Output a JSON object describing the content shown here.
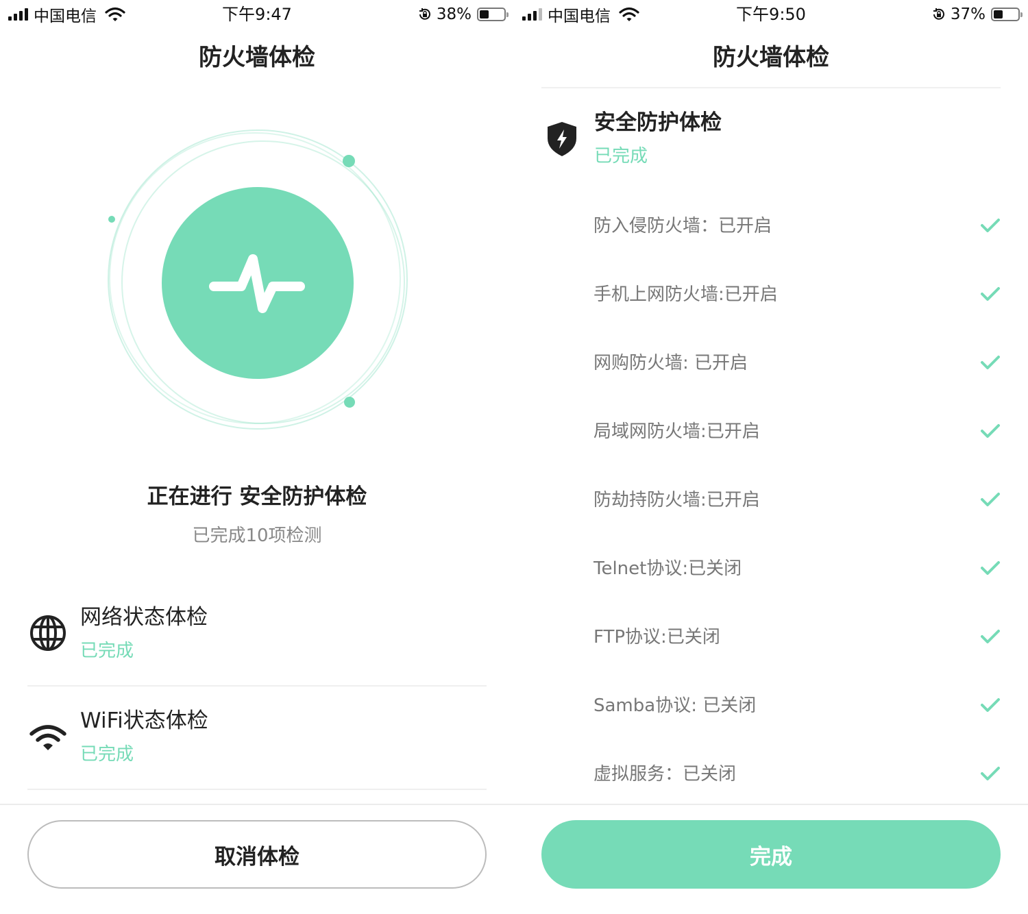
{
  "screens": {
    "left": {
      "status_bar": {
        "carrier": "中国电信",
        "time": "下午9:47",
        "battery": "38%",
        "battery_level": 0.38
      },
      "title": "防火墙体检",
      "scan_status": "正在进行 安全防护体检",
      "scan_count": "已完成10项检测",
      "checks": [
        {
          "icon": "globe-icon",
          "title": "网络状态体检",
          "status": "已完成"
        },
        {
          "icon": "wifi-icon",
          "title": "WiFi状态体检",
          "status": "已完成"
        }
      ],
      "cancel_label": "取消体检"
    },
    "right": {
      "status_bar": {
        "carrier": "中国电信",
        "time": "下午9:50",
        "battery": "37%",
        "battery_level": 0.37
      },
      "title": "防火墙体检",
      "section": {
        "icon": "shield-bolt-icon",
        "title": "安全防护体检",
        "status": "已完成"
      },
      "items": [
        {
          "label": "防入侵防火墙：已开启",
          "checked": true
        },
        {
          "label": "手机上网防火墙:已开启",
          "checked": true
        },
        {
          "label": "网购防火墙: 已开启",
          "checked": true
        },
        {
          "label": "局域网防火墙:已开启",
          "checked": true
        },
        {
          "label": "防劫持防火墙:已开启",
          "checked": true
        },
        {
          "label": "Telnet协议:已关闭",
          "checked": true
        },
        {
          "label": "FTP协议:已关闭",
          "checked": true
        },
        {
          "label": "Samba协议: 已关闭",
          "checked": true
        },
        {
          "label": "虚拟服务：已关闭",
          "checked": true
        }
      ],
      "done_label": "完成"
    }
  },
  "colors": {
    "accent": "#76dbb7",
    "text": "#222222",
    "muted": "#888888",
    "divider": "#efefef"
  }
}
